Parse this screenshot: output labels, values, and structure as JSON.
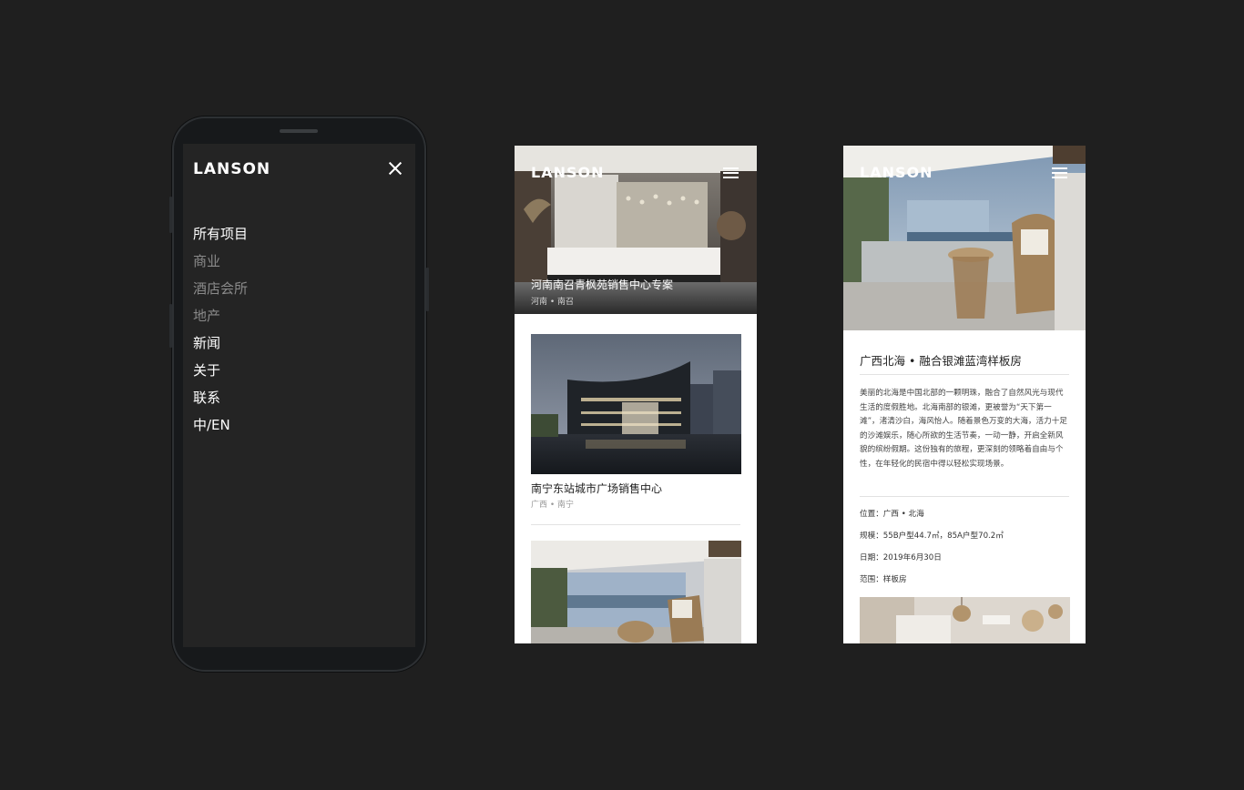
{
  "brand": "LANSON",
  "menu_screen": {
    "items": [
      {
        "label": "所有项目",
        "active": true
      },
      {
        "label": "商业",
        "active": false
      },
      {
        "label": "酒店会所",
        "active": false
      },
      {
        "label": "地产",
        "active": false
      },
      {
        "label": "新闻",
        "active": true
      },
      {
        "label": "关于",
        "active": true
      },
      {
        "label": "联系",
        "active": true
      },
      {
        "label": "中/EN",
        "active": true
      }
    ]
  },
  "list_screen": {
    "hero": {
      "title": "河南南召青枫苑销售中心专案",
      "location": "河南 • 南召"
    },
    "cards": [
      {
        "title": "南宁东站城市广场销售中心",
        "location": "广西 • 南宁"
      }
    ]
  },
  "detail_screen": {
    "title": "广西北海 • 融合银滩蓝湾样板房",
    "description": "美丽的北海是中国北部的一颗明珠，融合了自然风光与现代生活的度假胜地。北海南部的银滩，更被誉为“天下第一滩”，渚清沙白，海风怡人。随着景色万变的大海，活力十足的沙滩娱乐，随心所欲的生活节奏，一动一静，开启全新风貌的缤纷假期。这份独有的旅程，更深刻的领略着自由与个性，在年轻化的民宿中得以轻松实现场景。",
    "location": "位置：广西 • 北海",
    "scale": "规模：55B户型44.7㎡，85A户型70.2㎡",
    "date": "日期：2019年6月30日",
    "scope": "范围：样板房"
  },
  "colors": {
    "background": "#1f1f1f",
    "menu_bg": "#242424",
    "dim_text": "#8a8a8a"
  }
}
